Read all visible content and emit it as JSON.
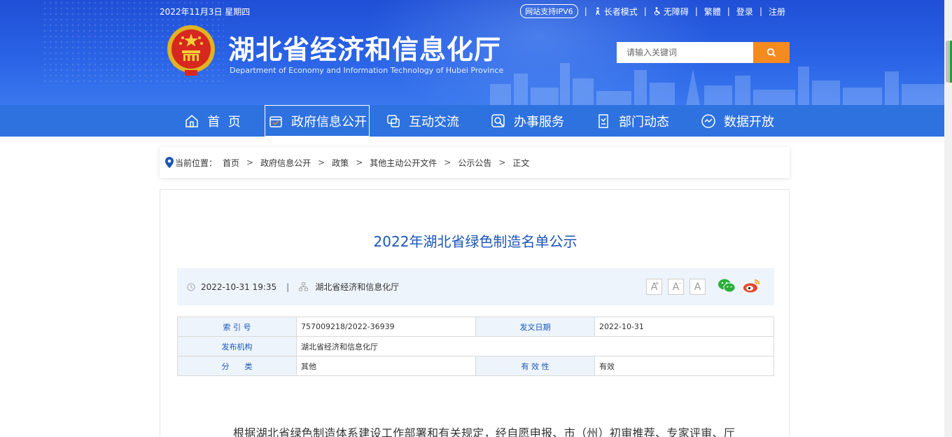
{
  "header": {
    "date": "2022年11月3日 星期四",
    "ipv6_badge": "网站支持IPV6",
    "elder_mode": "长者模式",
    "accessibility": "无障碍",
    "traditional": "繁體",
    "login": "登录",
    "register": "注册",
    "separator": "|",
    "site_title": "湖北省经济和信息化厅",
    "site_subtitle": "Department of Economy and Information Technology of Hubei Province",
    "search_placeholder": "请输入关键词",
    "colors": {
      "banner": "#2a63e6",
      "search_button": "#f58a1f"
    }
  },
  "nav": {
    "items": [
      {
        "label": "首  页",
        "icon": "home-icon"
      },
      {
        "label": "政府信息公开",
        "icon": "info-public-icon",
        "active": true
      },
      {
        "label": "互动交流",
        "icon": "interaction-icon"
      },
      {
        "label": "办事服务",
        "icon": "service-search-icon"
      },
      {
        "label": "部门动态",
        "icon": "department-news-icon"
      },
      {
        "label": "数据开放",
        "icon": "data-open-icon"
      }
    ],
    "color": "#2e72e0"
  },
  "breadcrumb": {
    "prefix": "当前位置：",
    "items": [
      "首页",
      "政府信息公开",
      "政策",
      "其他主动公开文件",
      "公示公告",
      "正文"
    ],
    "arrow": ">"
  },
  "article": {
    "title": "2022年湖北省绿色制造名单公示",
    "datetime": "2022-10-31 19:35",
    "source": "湖北省经济和信息化厅",
    "meta_separator": "|",
    "font_buttons": [
      "A",
      "A",
      "A"
    ],
    "font_button_marks": [
      "+",
      "-",
      ""
    ],
    "share": [
      "wechat-icon",
      "weibo-icon"
    ],
    "info_table": {
      "index_key": "索 引 号",
      "index_value": "757009218/2022-36939",
      "date_key": "发文日期",
      "date_value": "2022-10-31",
      "org_key": "发布机构",
      "org_value": "湖北省经济和信息化厅",
      "category_key": "分　　类",
      "category_value": "其他",
      "validity_key": "有 效 性",
      "validity_value": "有效"
    },
    "body_first_line": "根据湖北省绿色制造体系建设工作部署和有关规定，经自愿申报、市（州）初审推荐、专家评审、厅"
  }
}
